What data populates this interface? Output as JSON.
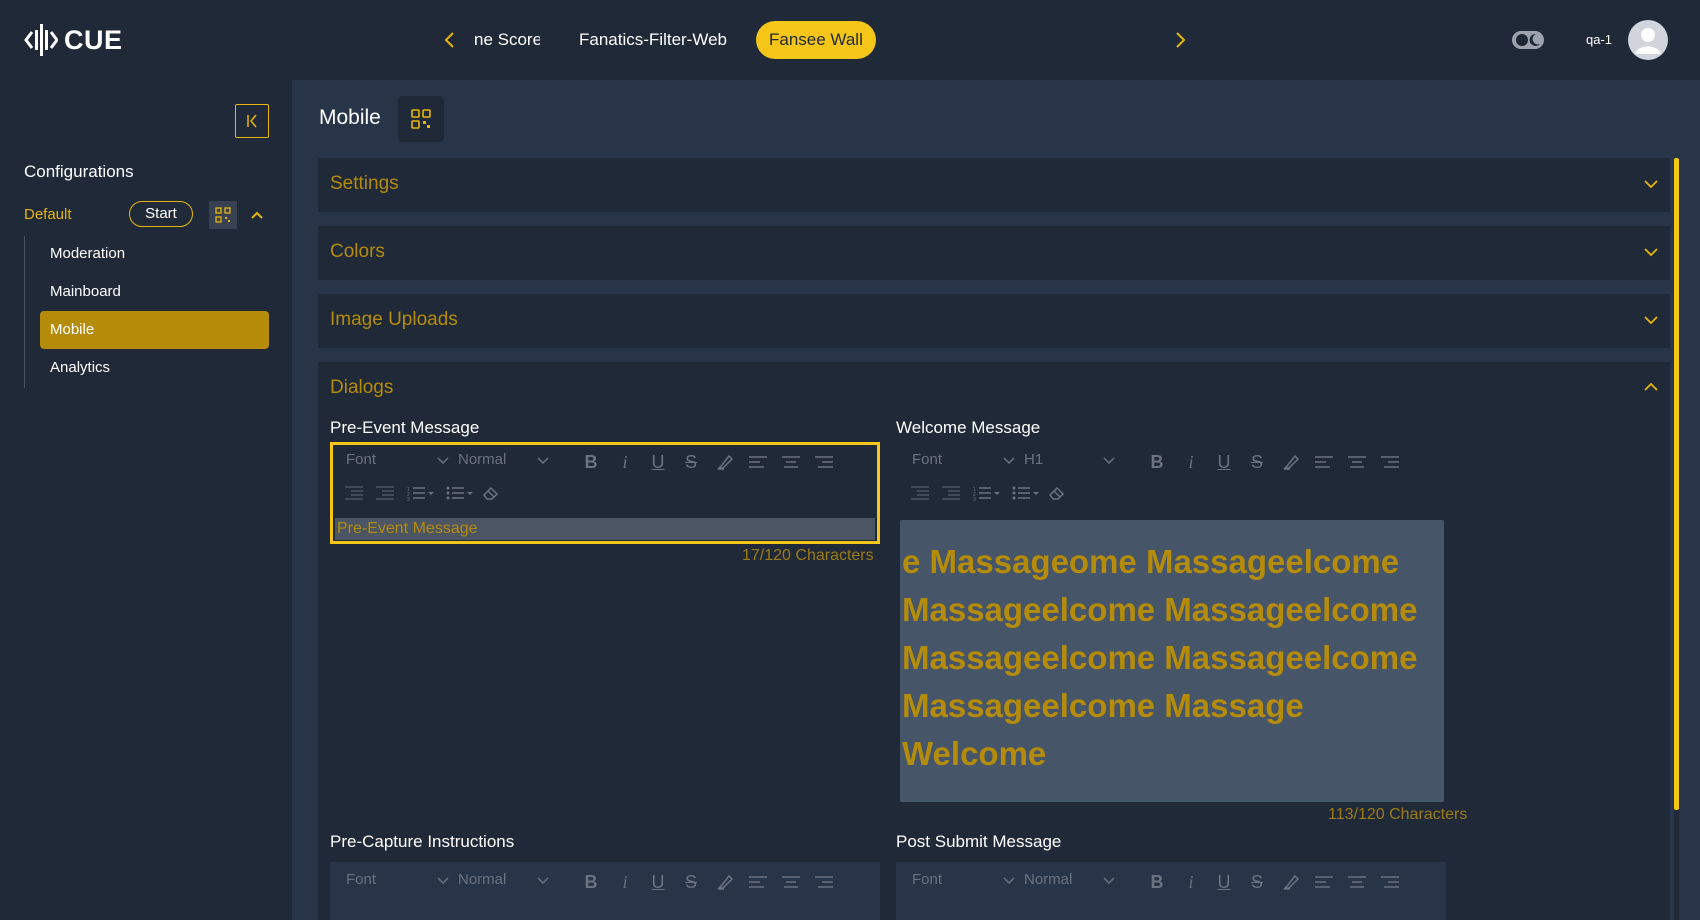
{
  "app": {
    "logo_text": "CUE",
    "tabs": [
      {
        "label": "ne Score"
      },
      {
        "label": "Fanatics-Filter-Web"
      },
      {
        "label": "Fansee Wall"
      }
    ],
    "username": "qa-1",
    "accent": "#f5c518"
  },
  "sidebar": {
    "title": "Configurations",
    "config_name": "Default",
    "start_label": "Start",
    "items": [
      {
        "label": "Moderation"
      },
      {
        "label": "Mainboard"
      },
      {
        "label": "Mobile"
      },
      {
        "label": "Analytics"
      }
    ],
    "active_item": "Mobile"
  },
  "main": {
    "title": "Mobile",
    "sections": [
      {
        "title": "Settings",
        "expanded": false
      },
      {
        "title": "Colors",
        "expanded": false
      },
      {
        "title": "Image Uploads",
        "expanded": false
      },
      {
        "title": "Dialogs",
        "expanded": true
      }
    ],
    "dialogs": {
      "pre_event": {
        "label": "Pre-Event Message",
        "font_select": "Font",
        "size_select": "Normal",
        "content": "Pre-Event Message",
        "counter": "17/120 Characters"
      },
      "welcome": {
        "label": "Welcome Message",
        "font_select": "Font",
        "size_select": "H1",
        "content": "e Massageome Massageelcome Massageelcome Massageelcome Massageelcome Massageelcome Massageelcome Massage Welcome",
        "counter": "113/120 Characters"
      },
      "pre_capture": {
        "label": "Pre-Capture Instructions",
        "font_select": "Font",
        "size_select": "Normal"
      },
      "post_submit": {
        "label": "Post Submit Message",
        "font_select": "Font",
        "size_select": "Normal"
      }
    }
  }
}
